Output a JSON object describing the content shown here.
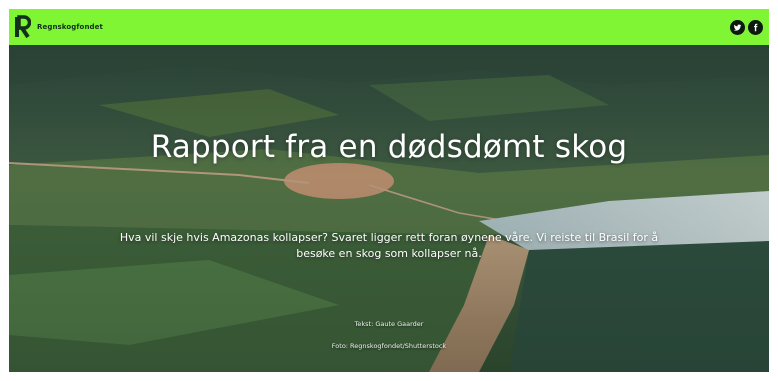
{
  "header": {
    "brand_name": "Regnskogfondet",
    "background_color": "#7ff534",
    "logo_icon": "regnskogfondet-logo-icon",
    "social": [
      {
        "icon": "twitter-icon"
      },
      {
        "icon": "facebook-icon"
      }
    ]
  },
  "hero": {
    "title": "Rapport fra en dødsdømt skog",
    "lede": "Hva vil skje hvis Amazonas kollapser? Svaret ligger rett foran øynene våre. Vi reiste til Brasil for å besøke en skog som kollapser nå.",
    "credit_text": "Tekst: Gaute Gaarder",
    "credit_photo": "Foto: Regnskogfondet/Shutterstock"
  }
}
